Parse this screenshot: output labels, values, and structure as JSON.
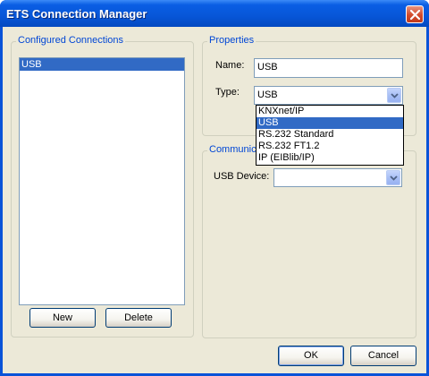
{
  "window": {
    "title": "ETS Connection Manager"
  },
  "connections": {
    "group_label": "Configured Connections",
    "items": [
      "USB"
    ],
    "new_label": "New",
    "delete_label": "Delete"
  },
  "properties": {
    "group_label": "Properties",
    "name_label": "Name:",
    "name_value": "USB",
    "type_label": "Type:",
    "type_value": "USB",
    "type_options": [
      "KNXnet/IP",
      "USB",
      "RS.232 Standard",
      "RS.232 FT1.2",
      "IP (EIBlib/IP)"
    ],
    "type_selected_index": 1
  },
  "communication": {
    "group_label": "Communic",
    "usb_device_label": "USB Device:",
    "usb_device_value": ""
  },
  "footer": {
    "ok_label": "OK",
    "cancel_label": "Cancel"
  },
  "colors": {
    "title_bar": "#0756d8",
    "selection": "#316ac5",
    "group_label": "#0046d5",
    "dialog_bg": "#ece9d8"
  }
}
